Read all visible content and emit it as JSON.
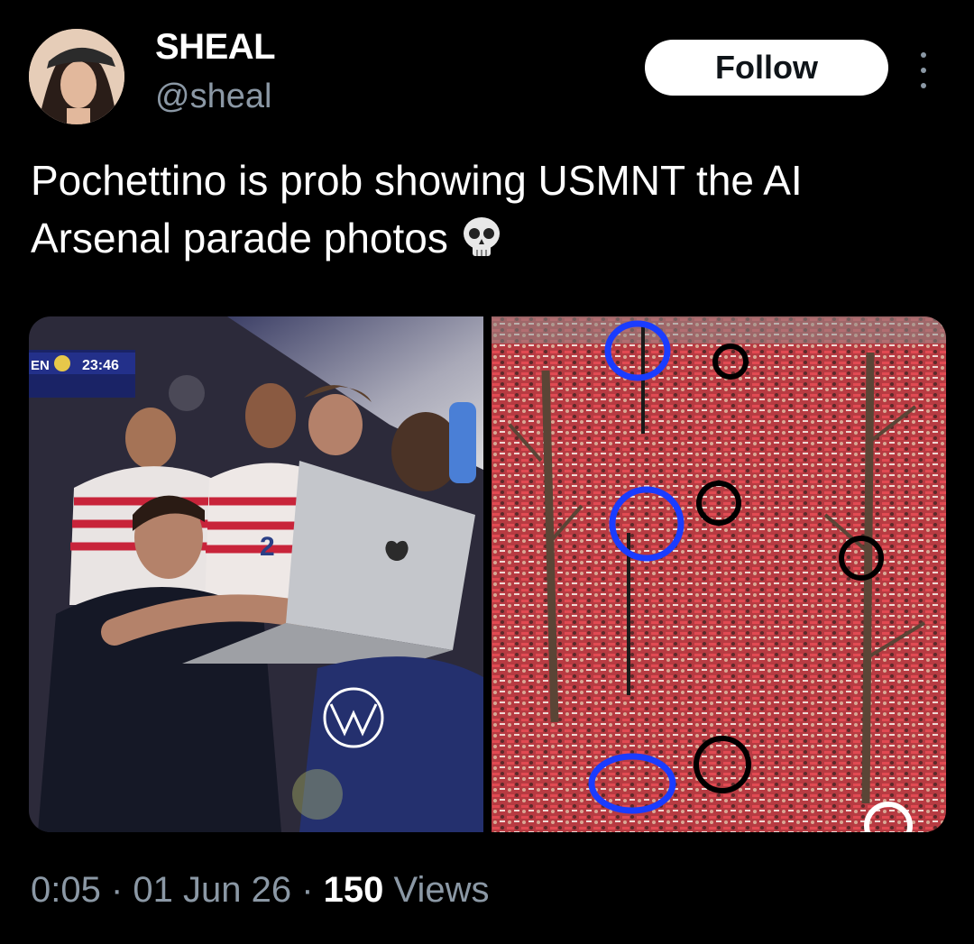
{
  "user": {
    "display_name": "SHEAL",
    "handle": "@sheal",
    "avatar_icon": "profile-avatar"
  },
  "follow_label": "Follow",
  "tweet": {
    "text": "Pochettino is prob showing USMNT the AI Arsenal parade photos",
    "emoji": "skull-emoji"
  },
  "media": {
    "left_photo": {
      "scoreboard_team": "EN",
      "scoreboard_time": "23:46",
      "jersey_number": "2"
    },
    "right_photo": {
      "annotation_colors": [
        "#1a3cff",
        "#000000",
        "#ffffff"
      ]
    }
  },
  "meta": {
    "time": "0:05",
    "sep1": " · ",
    "date": "01 Jun 26",
    "sep2": " · ",
    "views_count": "150",
    "views_label": " Views"
  }
}
